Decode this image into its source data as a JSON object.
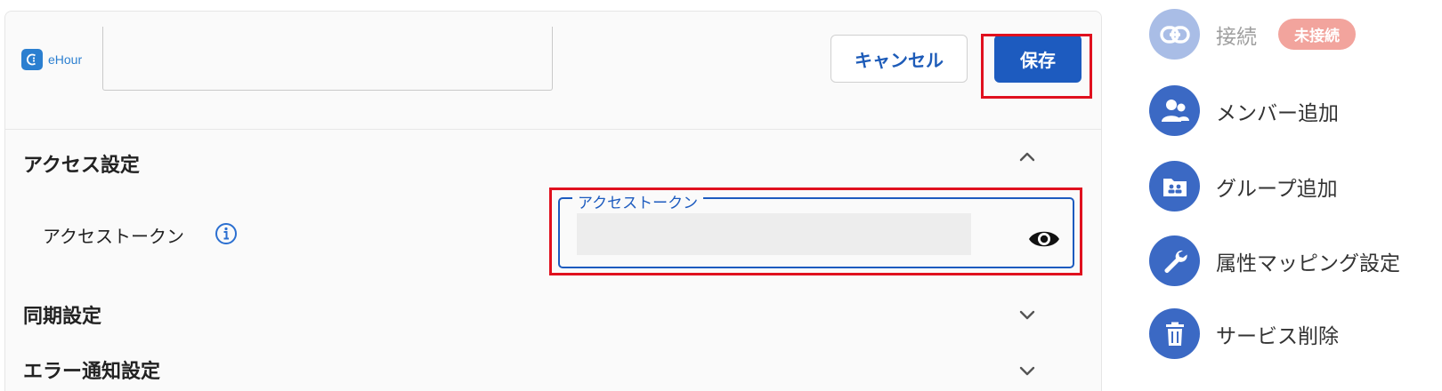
{
  "header": {
    "logo_text": "eHour",
    "cancel_label": "キャンセル",
    "save_label": "保存"
  },
  "sections": {
    "access": {
      "title": "アクセス設定"
    },
    "sync": {
      "title": "同期設定"
    },
    "error": {
      "title": "エラー通知設定"
    }
  },
  "access_token": {
    "row_label": "アクセストークン",
    "field_label": "アクセストークン",
    "value": ""
  },
  "menu": {
    "connect": {
      "label": "接続",
      "status": "未接続"
    },
    "add_member": {
      "label": "メンバー追加"
    },
    "add_group": {
      "label": "グループ追加"
    },
    "attribute_mapping": {
      "label": "属性マッピング設定"
    },
    "delete_service": {
      "label": "サービス削除"
    }
  },
  "colors": {
    "primary": "#1d5bbf",
    "highlight": "#e0101e",
    "badge_bg": "#f2a49d",
    "menu_icon_bg": "#3b69c4"
  }
}
